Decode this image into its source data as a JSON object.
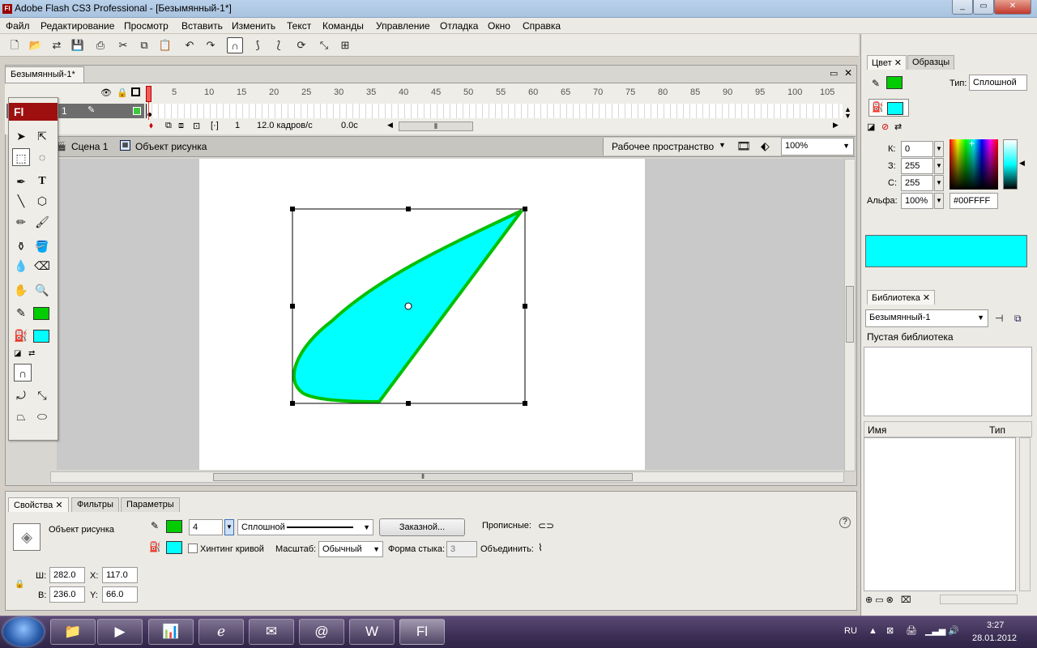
{
  "window": {
    "title": "Adobe Flash CS3 Professional - [Безымянный-1*]",
    "icon": "Fl"
  },
  "menu": [
    "Файл",
    "Редактирование",
    "Просмотр",
    "Вставить",
    "Изменить",
    "Текст",
    "Команды",
    "Управление",
    "Отладка",
    "Окно",
    "Справка"
  ],
  "document": {
    "tab": "Безымянный-1*"
  },
  "timeline": {
    "layer_number": "1",
    "ticks": [
      "1",
      "5",
      "10",
      "15",
      "20",
      "25",
      "30",
      "35",
      "40",
      "45",
      "50",
      "55",
      "60",
      "65",
      "70",
      "75",
      "80",
      "85",
      "90",
      "95",
      "100",
      "105"
    ],
    "current_frame": "1",
    "fps": "12.0 кадров/с",
    "time": "0.0с"
  },
  "scene": {
    "scene_label": "Сцена 1",
    "object_label": "Объект рисунка",
    "workspace": "Рабочее пространство",
    "zoom": "100%"
  },
  "tools": {
    "logo": "Fl",
    "stroke_color": "#00cc00",
    "fill_color": "#00ffff"
  },
  "shape": {
    "fill": "#00ffff",
    "stroke": "#00c000"
  },
  "properties": {
    "tabs": [
      "Свойства",
      "Фильтры",
      "Параметры"
    ],
    "object_type": "Объект рисунка",
    "stroke_width": "4",
    "stroke_style": "Сплошной",
    "custom_button": "Заказной...",
    "caps_label": "Прописные:",
    "hinting_label": "Хинтинг кривой",
    "scale_label": "Масштаб:",
    "scale_value": "Обычный",
    "miter_label": "Форма стыка:",
    "miter_value": "3",
    "join_label": "Объединить:",
    "w_label": "Ш:",
    "w_value": "282.0",
    "h_label": "В:",
    "h_value": "236.0",
    "x_label": "X:",
    "x_value": "117.0",
    "y_label": "Y:",
    "y_value": "66.0",
    "help": "?"
  },
  "color_panel": {
    "tabs": [
      "Цвет",
      "Образцы"
    ],
    "type_label": "Тип:",
    "type_value": "Сплошной",
    "r_label": "К:",
    "r_value": "0",
    "g_label": "З:",
    "g_value": "255",
    "b_label": "С:",
    "b_value": "255",
    "alpha_label": "Альфа:",
    "alpha_value": "100%",
    "hex": "#00FFFF"
  },
  "library": {
    "tab": "Библиотека",
    "document": "Безымянный-1",
    "empty_text": "Пустая библиотека",
    "col_name": "Имя",
    "col_type": "Тип"
  },
  "taskbar": {
    "lang": "RU",
    "time": "3:27",
    "date": "28.01.2012"
  }
}
